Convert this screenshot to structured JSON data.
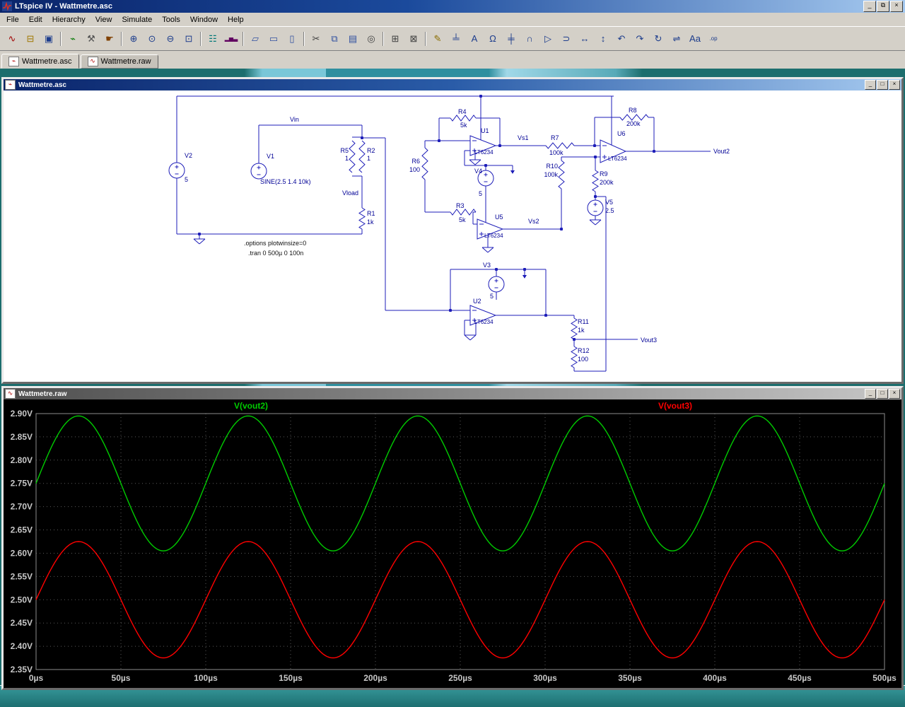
{
  "window": {
    "title": "LTspice IV - Wattmetre.asc",
    "controls": {
      "minimize": "_",
      "maximize": "□",
      "restore": "⧉",
      "close": "×"
    }
  },
  "menu": {
    "items": [
      "File",
      "Edit",
      "Hierarchy",
      "View",
      "Simulate",
      "Tools",
      "Window",
      "Help"
    ]
  },
  "toolbar": {
    "buttons": [
      {
        "name": "new-schematic",
        "glyph": "∿",
        "color": "#a00000"
      },
      {
        "name": "open-file",
        "glyph": "⊟",
        "color": "#a07800"
      },
      {
        "name": "save",
        "glyph": "▣",
        "color": "#1c3c8c"
      },
      {
        "name": "run-simulation",
        "glyph": "⌁",
        "color": "#007800"
      },
      {
        "name": "control-panel",
        "glyph": "⚒",
        "color": "#505050"
      },
      {
        "name": "halt",
        "glyph": "☛",
        "color": "#804000"
      },
      {
        "name": "zoom-in",
        "glyph": "⊕",
        "color": "#1c3c8c"
      },
      {
        "name": "zoom-back",
        "glyph": "⊙",
        "color": "#1c3c8c"
      },
      {
        "name": "zoom-out",
        "glyph": "⊖",
        "color": "#1c3c8c"
      },
      {
        "name": "zoom-full",
        "glyph": "⊡",
        "color": "#1c3c8c"
      },
      {
        "name": "autorange",
        "glyph": "☷",
        "color": "#007878"
      },
      {
        "name": "spectrum",
        "glyph": "▂▅▃",
        "color": "#600060"
      },
      {
        "name": "cascade-windows",
        "glyph": "▱",
        "color": "#3050a0"
      },
      {
        "name": "tile-horizontal",
        "glyph": "▭",
        "color": "#3050a0"
      },
      {
        "name": "tile-vertical",
        "glyph": "▯",
        "color": "#3050a0"
      },
      {
        "name": "cut",
        "glyph": "✂",
        "color": "#404040"
      },
      {
        "name": "copy",
        "glyph": "⧉",
        "color": "#3050a0"
      },
      {
        "name": "paste",
        "glyph": "▤",
        "color": "#3050a0"
      },
      {
        "name": "find",
        "glyph": "◎",
        "color": "#404040"
      },
      {
        "name": "print",
        "glyph": "⊞",
        "color": "#404040"
      },
      {
        "name": "print-preview",
        "glyph": "⊠",
        "color": "#404040"
      },
      {
        "name": "draw-wire",
        "glyph": "✎",
        "color": "#8a6d00"
      },
      {
        "name": "place-ground",
        "glyph": "╧",
        "color": "#1c3c8c"
      },
      {
        "name": "label-net",
        "glyph": "A",
        "color": "#1c3c8c"
      },
      {
        "name": "place-resistor",
        "glyph": "Ω",
        "color": "#1c3c8c"
      },
      {
        "name": "place-capacitor",
        "glyph": "╪",
        "color": "#1c3c8c"
      },
      {
        "name": "place-inductor",
        "glyph": "∩",
        "color": "#1c3c8c"
      },
      {
        "name": "place-diode",
        "glyph": "▷",
        "color": "#1c3c8c"
      },
      {
        "name": "place-component",
        "glyph": "⊃",
        "color": "#1c3c8c"
      },
      {
        "name": "move",
        "glyph": "↔",
        "color": "#1c3c8c"
      },
      {
        "name": "drag",
        "glyph": "↕",
        "color": "#1c3c8c"
      },
      {
        "name": "undo",
        "glyph": "↶",
        "color": "#1c3c8c"
      },
      {
        "name": "redo",
        "glyph": "↷",
        "color": "#1c3c8c"
      },
      {
        "name": "rotate",
        "glyph": "↻",
        "color": "#1c3c8c"
      },
      {
        "name": "mirror",
        "glyph": "⇌",
        "color": "#1c3c8c"
      },
      {
        "name": "text-tool",
        "glyph": "Aa",
        "color": "#1c3c8c"
      },
      {
        "name": "spice-directive",
        "glyph": ".op",
        "color": "#1c3c8c"
      }
    ]
  },
  "tabs": [
    {
      "label": "Wattmetre.asc",
      "active": true
    },
    {
      "label": "Wattmetre.raw",
      "active": false
    }
  ],
  "schematic_window": {
    "title": "Wattmetre.asc",
    "labels": {
      "vin": "Vin",
      "v2_name": "V2",
      "v2_value": "5",
      "v1_name": "V1",
      "v1_value": "SINE(2.5 1.4 10k)",
      "r5_name": "R5",
      "r5_value": "1",
      "r2_name": "R2",
      "r2_value": "1",
      "vload": "Vload",
      "r1_name": "R1",
      "r1_value": "1k",
      "r6_name": "R6",
      "r6_value": "100",
      "r4_name": "R4",
      "r4_value": "5k",
      "u1_name": "U1",
      "u1_part": "LT6234",
      "vs1": "Vs1",
      "r7_name": "R7",
      "r7_value": "100k",
      "v4_name": "V4",
      "v4_value": "5",
      "r3_name": "R3",
      "r3_value": "5k",
      "u5_name": "U5",
      "u5_part": "LT6234",
      "vs2": "Vs2",
      "r10_name": "R10",
      "r10_value": "100k",
      "r8_name": "R8",
      "r8_value": "200k",
      "u6_name": "U6",
      "u6_part": "LT6234",
      "vout2": "Vout2",
      "r9_name": "R9",
      "r9_value": "200k",
      "v5_name": "V5",
      "v5_value": "2.5",
      "v3_name": "V3",
      "v3_value": "5",
      "u2_name": "U2",
      "u2_part": "LT6234",
      "r11_name": "R11",
      "r11_value": "1k",
      "vout3": "Vout3",
      "r12_name": "R12",
      "r12_value": "100",
      "directive_options": ".options plotwinsize=0",
      "directive_tran": ".tran 0 500µ 0 100n"
    }
  },
  "waveform_window": {
    "title": "Wattmetre.raw"
  },
  "chart_data": {
    "type": "line",
    "title": "",
    "background": "#000000",
    "grid": "dotted",
    "legend_position": "top",
    "x": {
      "unit": "µs",
      "min": 0,
      "max": 500,
      "tick_step": 50,
      "tick_labels": [
        "0µs",
        "50µs",
        "100µs",
        "150µs",
        "200µs",
        "250µs",
        "300µs",
        "350µs",
        "400µs",
        "450µs",
        "500µs"
      ]
    },
    "y": {
      "unit": "V",
      "min": 2.35,
      "max": 2.9,
      "tick_step": 0.05,
      "tick_labels": [
        "2.90V",
        "2.85V",
        "2.80V",
        "2.75V",
        "2.70V",
        "2.65V",
        "2.60V",
        "2.55V",
        "2.50V",
        "2.45V",
        "2.40V",
        "2.35V"
      ]
    },
    "series": [
      {
        "name": "V(vout2)",
        "color": "#00cc00",
        "waveform": "sine",
        "offset_v": 2.75,
        "amplitude_v": 0.145,
        "period_us": 100,
        "phase_deg": 0
      },
      {
        "name": "V(vout3)",
        "color": "#ff0000",
        "waveform": "sine",
        "offset_v": 2.5,
        "amplitude_v": 0.125,
        "period_us": 100,
        "phase_deg": 0
      }
    ]
  }
}
